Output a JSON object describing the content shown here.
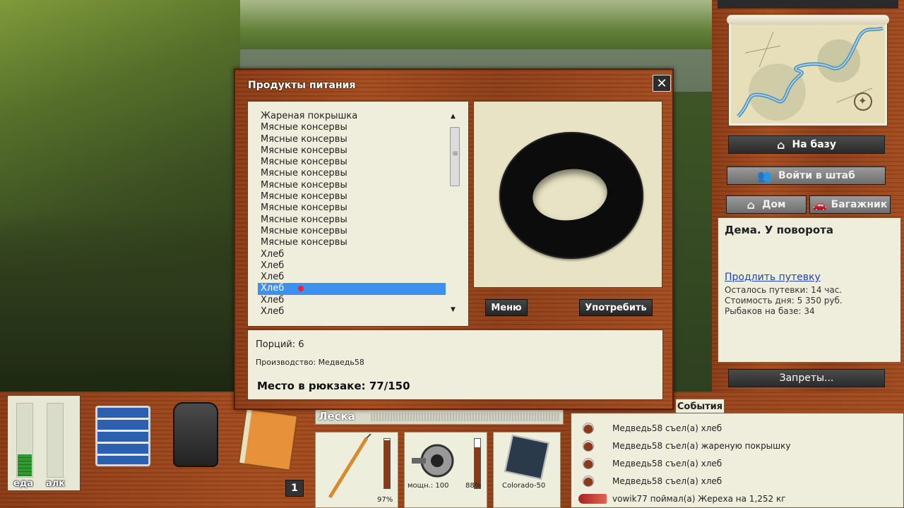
{
  "dialog": {
    "title": "Продукты питания",
    "close_glyph": "✕",
    "items": [
      "Жареная покрышка",
      "Мясные консервы",
      "Мясные консервы",
      "Мясные консервы",
      "Мясные консервы",
      "Мясные консервы",
      "Мясные консервы",
      "Мясные консервы",
      "Мясные консервы",
      "Мясные консервы",
      "Мясные консервы",
      "Мясные консервы",
      "Хлеб",
      "Хлеб",
      "Хлеб",
      "Хлеб",
      "Хлеб",
      "Хлеб"
    ],
    "selected_index": 15,
    "menu_button": "Меню",
    "use_button": "Употребить",
    "portions": "Порций: 6",
    "production": "Производство: Медведь58",
    "backpack_space": "Место в рюкзаке: 77/150"
  },
  "sidebar": {
    "to_base": "На базу",
    "enter_hq": "Войти в штаб",
    "home": "Дом",
    "trunk": "Багажник",
    "location": "Дема. У поворота",
    "extend_trip": "Продлить путевку",
    "trip_left": "Осталось путевки: 14 час.",
    "day_cost": "Стоимость дня: 5 350 руб.",
    "fishers_on_base": "Рыбаков на базе: 34",
    "bans": "Запреты..."
  },
  "meters": {
    "food_label": "еда",
    "alc_label": "алк",
    "food_level": 0.3,
    "alc_level": 0
  },
  "inventory": {
    "count_badge": "1",
    "line_label": "Леска",
    "rod_percent": "97%",
    "reel_power": "мощн.: 100",
    "reel_percent": "88%",
    "line_name": "Colorado-50"
  },
  "events": {
    "tab_label": "События",
    "items": [
      "Медведь58 съел(а) хлеб",
      "Медведь58 съел(а) жареную покрышку",
      "Медведь58 съел(а) хлеб",
      "Медведь58 съел(а) хлеб",
      "vowik77 поймал(а) Жереха на 1,252 кг"
    ]
  },
  "colors": {
    "selection": "#3d8ff0",
    "panel": "#efeedd",
    "wood": "#a44a1c"
  }
}
